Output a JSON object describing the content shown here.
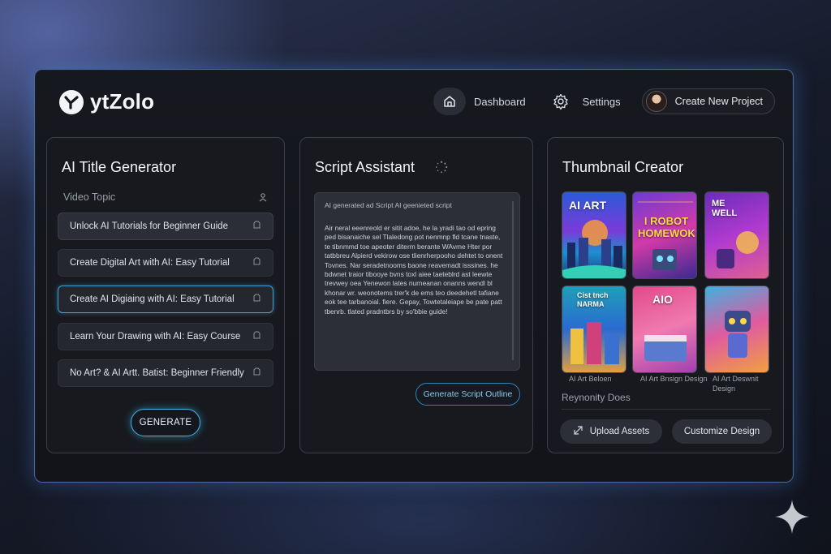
{
  "app": {
    "name": "ytZolo"
  },
  "nav": {
    "dashboard_label": "Dashboard",
    "settings_label": "Settings",
    "create_project_label": "Create New Project"
  },
  "title_generator": {
    "title": "AI Title Generator",
    "topic_label": "Video Topic",
    "items": [
      {
        "label": "Unlock AI Tutorials for Beginner Guide",
        "state": "hover"
      },
      {
        "label": "Create Digital Art with AI: Easy Tutorial",
        "state": "default"
      },
      {
        "label": "Create AI Digiaing with AI: Easy Tutorial",
        "state": "selected"
      },
      {
        "label": "Learn Your Drawing with AI: Easy Course",
        "state": "default"
      },
      {
        "label": "No Art? & AI Artt. Batist: Beginner Friendly",
        "state": "default"
      }
    ],
    "generate_label": "GENERATE"
  },
  "script_assistant": {
    "title": "Script Assistant",
    "box_heading": "AI generated ad Script AI geenieted script",
    "body": "Air neral eeenreold er sitit adoe, he la yradi tao od epring ped bisanaiche sel Tlaledong pot nenmnp fld tcane tnaste, te tibnmmd toe apeoter diterm berante WAvme Hter por tatbbreu Alpierd vekirow ose tlienrherpooho dehtet to onent Tovnes. Nar seradetnooms baone reavemadt isssines. he bdwnet traior tibooye bvns toxl aiee taeteblrd ast leewte trevwey oea Yenewon lates nurneanan onanns wendl bl khonar wr. weonotems trer'k de ems teo deedehetl tafiane eok tee tarbanoial. fiere. Gepay, Towtetaleiape be pate patt tbenrb. tlated pradntbrs by so'bbie guide!",
    "outline_label": "Generate Script Outline"
  },
  "thumbnail_creator": {
    "title": "Thumbnail Creator",
    "thumbs": [
      {
        "text": "AI ART",
        "caption": ""
      },
      {
        "text": "I ROBOT HOMEWOK?!",
        "caption": ""
      },
      {
        "text": "ME WELL",
        "caption": ""
      },
      {
        "text": "Cist tnch NARMA",
        "caption": "AI Art Beloen"
      },
      {
        "text": "AIO",
        "caption": "AI Art Bnsign Design"
      },
      {
        "text": "",
        "caption": "AI Art Deswnit Design"
      }
    ],
    "section_label": "Reynonity Does",
    "upload_label": "Upload Assets",
    "customize_label": "Customize Design"
  },
  "colors": {
    "accent": "#3fb3e6",
    "panel_border": "#3b3f49",
    "app_border": "#6eaaff"
  },
  "icons": [
    "logo-icon",
    "home-icon",
    "gear-icon",
    "avatar",
    "edit-icon",
    "spinner-icon",
    "location-icon",
    "upload-icon",
    "sparkle-icon"
  ]
}
